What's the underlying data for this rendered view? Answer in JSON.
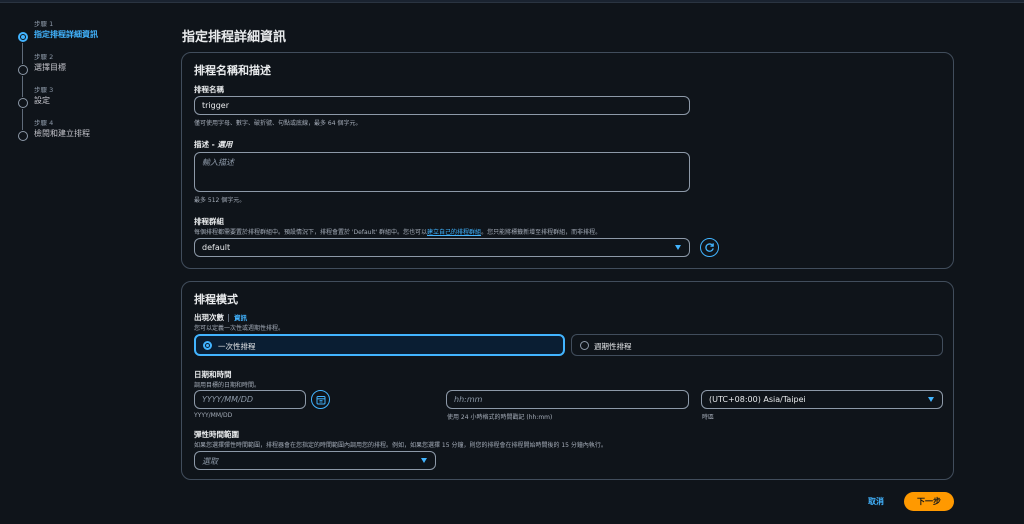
{
  "steps": [
    {
      "num": "步驟 1",
      "label": "指定排程詳細資訊"
    },
    {
      "num": "步驟 2",
      "label": "選擇目標"
    },
    {
      "num": "步驟 3",
      "label": "設定"
    },
    {
      "num": "步驟 4",
      "label": "檢閱和建立排程"
    }
  ],
  "page_title": "指定排程詳細資訊",
  "section_name": {
    "title": "排程名稱和描述",
    "name_label": "排程名稱",
    "name_value": "trigger",
    "name_hint": "僅可使用字母、數字、破折號、句點或底線，最多 64 個字元。",
    "desc_label": "描述 - ",
    "desc_optional": "選用",
    "desc_placeholder": "輸入描述",
    "desc_hint": "最多 512 個字元。",
    "group_label": "排程群組",
    "group_hint_before": "每個排程都需要置於排程群組中。預設情況下，排程會置於 'Default' 群組中。您也可以",
    "group_hint_link": "建立自己的排程群組",
    "group_hint_after": "。您只能將標籤新增至排程群組，而非排程。",
    "group_value": "default",
    "refresh_icon": "refresh-icon"
  },
  "section_pattern": {
    "title": "排程模式",
    "occurrence_label": "出現次數",
    "info": "資訊",
    "occurrence_hint": "您可以定義一次性或週期性排程。",
    "option_one_time": "一次性排程",
    "option_recurring": "週期性排程",
    "selected": "one_time",
    "datetime_label": "日期和時間",
    "datetime_hint": "調用目標的日期和時間。",
    "date_placeholder": "YYYY/MM/DD",
    "date_format": "YYYY/MM/DD",
    "time_placeholder": "hh:mm",
    "time_hint": "使用 24 小時格式的時間戳記 (hh:mm)",
    "timezone_value": "(UTC+08:00) Asia/Taipei",
    "timezone_hint": "時區",
    "flex_label": "彈性時間範圍",
    "flex_hint": "如果您選擇彈性時間範圍，排程器會在您指定的時間範圍內調用您的排程。例如，如果您選擇 15 分鐘，則您的排程會在排程開始時間後的 15 分鐘內執行。",
    "flex_value": "選取"
  },
  "footer": {
    "cancel": "取消",
    "next": "下一步"
  },
  "colors": {
    "accent": "#42b4ff",
    "primary_button": "#ff9900",
    "background": "#0f141a"
  }
}
